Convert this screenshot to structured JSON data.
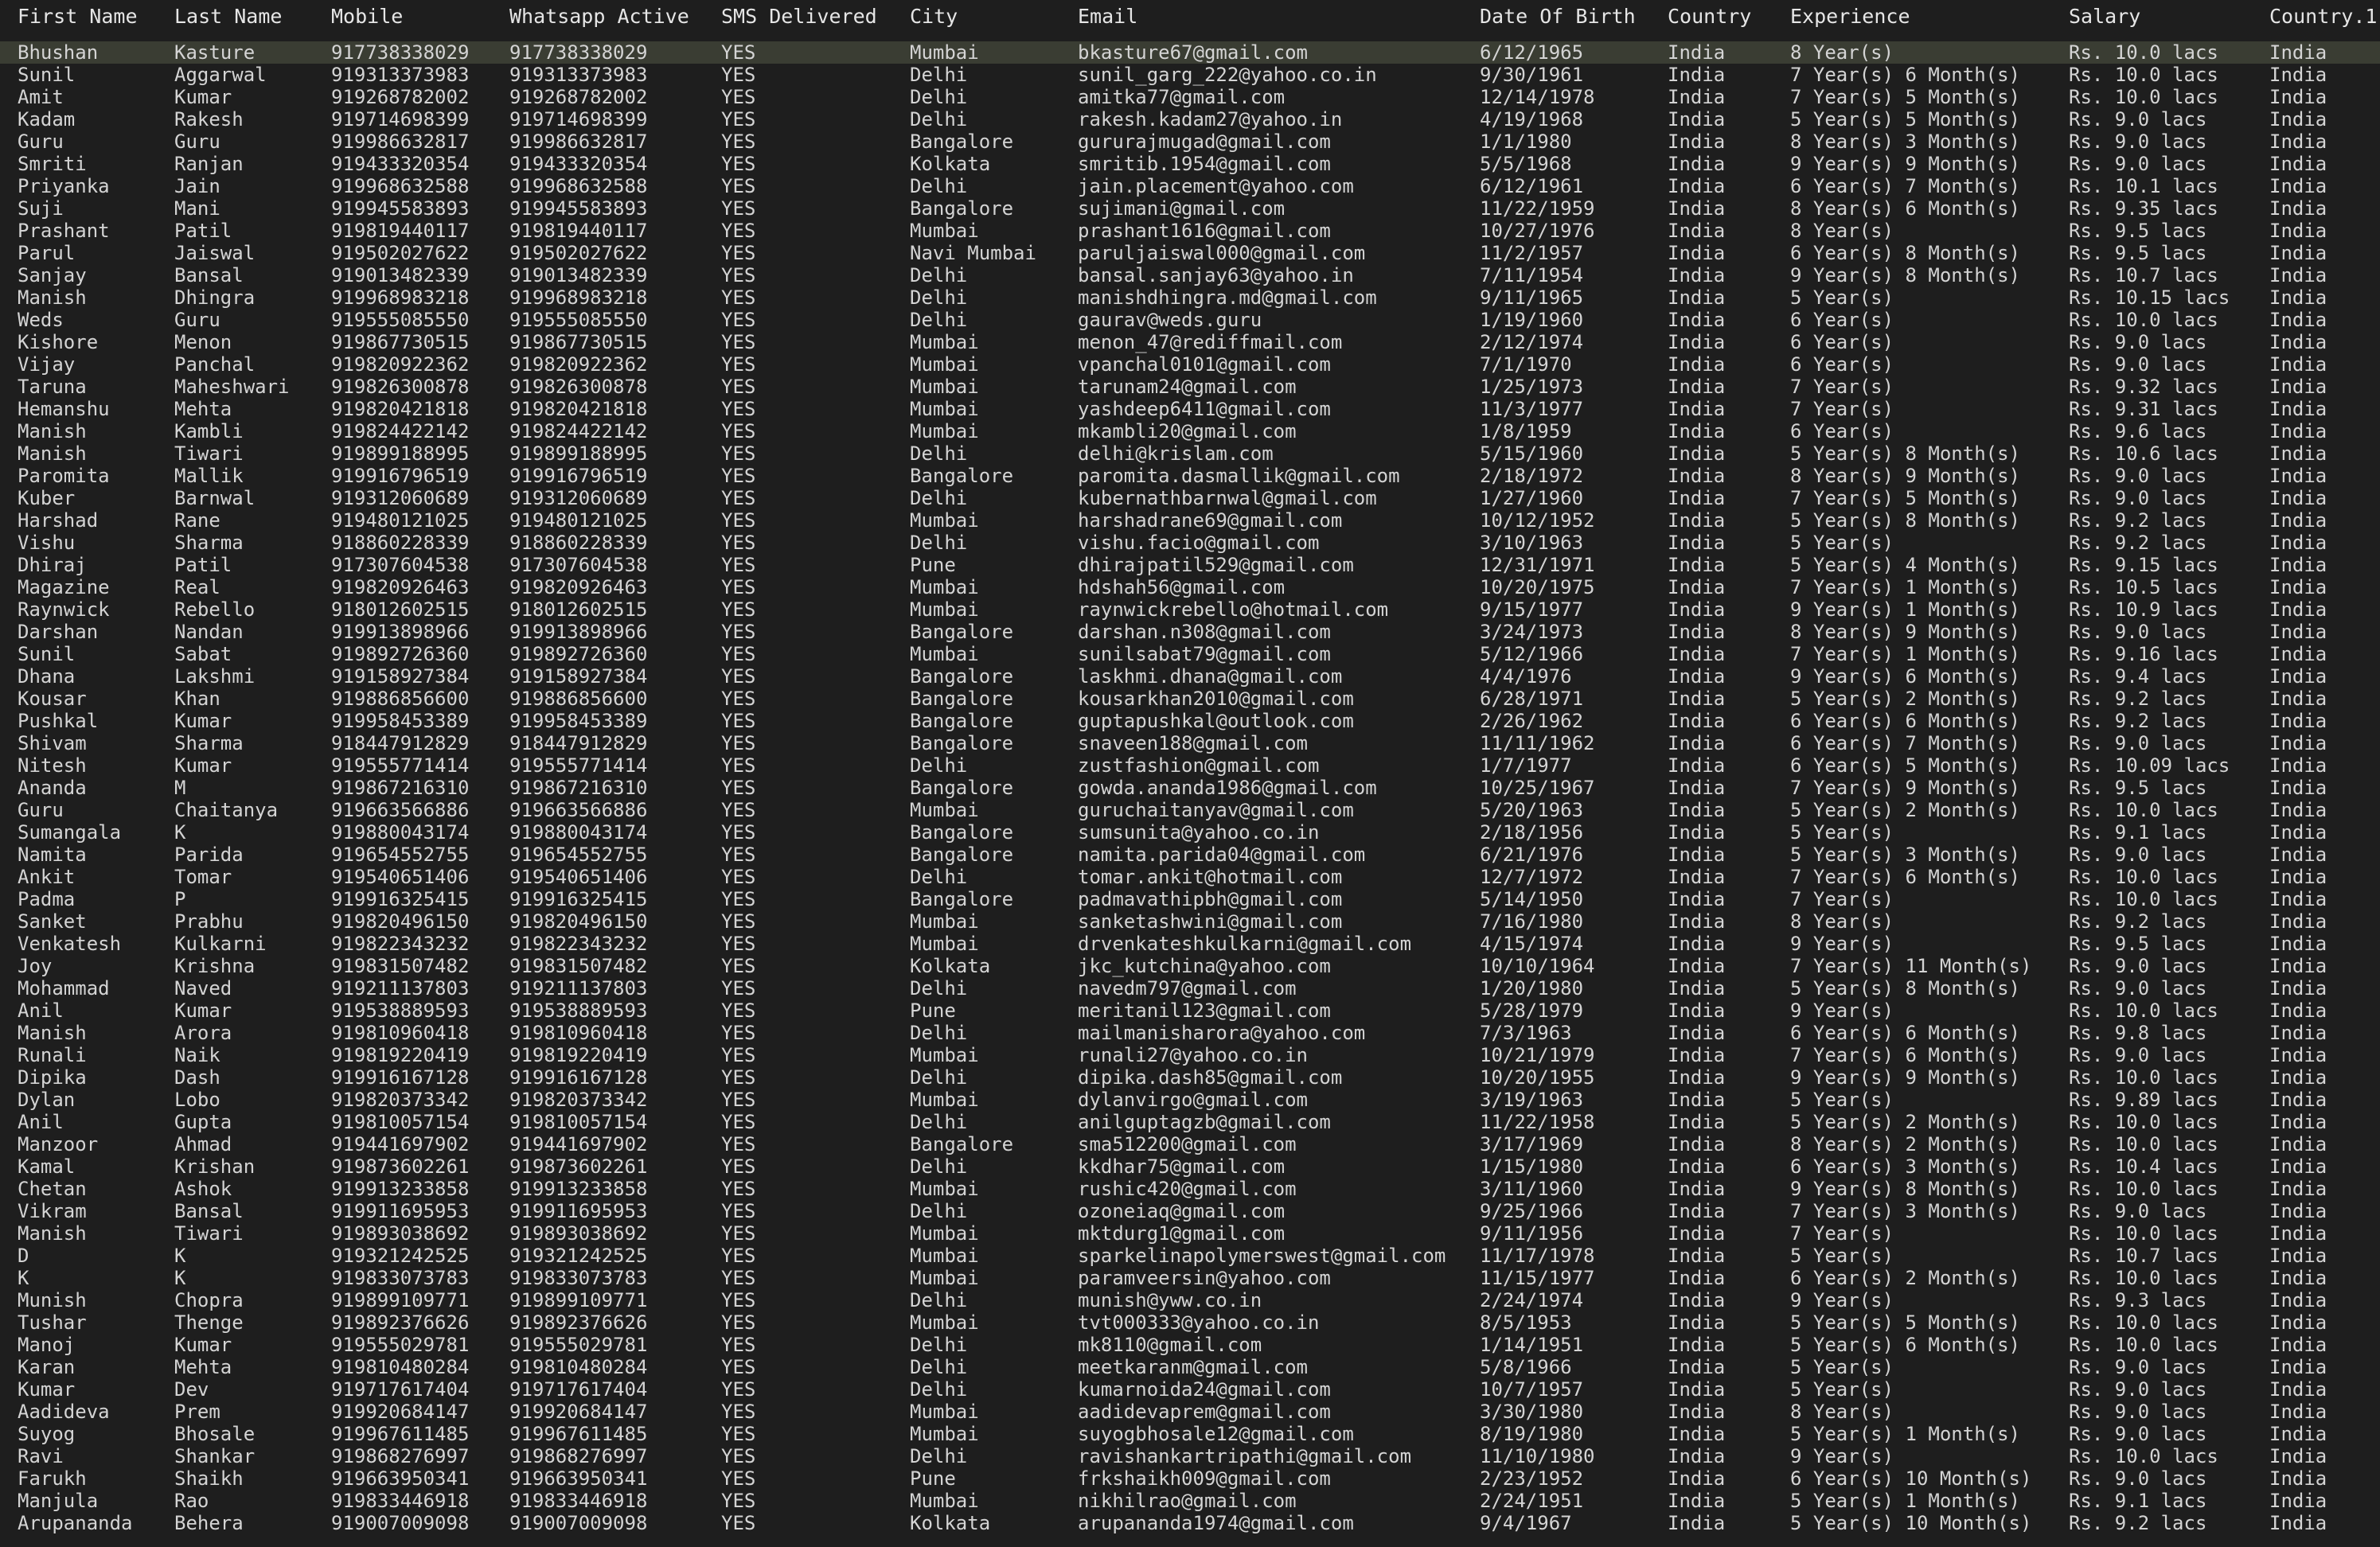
{
  "columns": [
    "First Name",
    "Last Name",
    "Mobile",
    "Whatsapp Active",
    "SMS Delivered",
    "City",
    "Email",
    "Date Of Birth",
    "Country",
    "Experience",
    "Salary",
    "Country.1"
  ],
  "rows": [
    [
      "Bhushan",
      "Kasture",
      "917738338029",
      "917738338029",
      "YES",
      "Mumbai",
      "bkasture67@gmail.com",
      "6/12/1965",
      "India",
      "8 Year(s)",
      "Rs. 10.0 lacs",
      "India"
    ],
    [
      "Sunil",
      "Aggarwal",
      "919313373983",
      "919313373983",
      "YES",
      "Delhi",
      "sunil_garg_222@yahoo.co.in",
      "9/30/1961",
      "India",
      "7 Year(s) 6 Month(s)",
      "Rs. 10.0 lacs",
      "India"
    ],
    [
      "Amit",
      "Kumar",
      "919268782002",
      "919268782002",
      "YES",
      "Delhi",
      "amitka77@gmail.com",
      "12/14/1978",
      "India",
      "7 Year(s) 5 Month(s)",
      "Rs. 10.0 lacs",
      "India"
    ],
    [
      "Kadam",
      "Rakesh",
      "919714698399",
      "919714698399",
      "YES",
      "Delhi",
      "rakesh.kadam27@yahoo.in",
      "4/19/1968",
      "India",
      "5 Year(s) 5 Month(s)",
      "Rs. 9.0 lacs",
      "India"
    ],
    [
      "Guru",
      "Guru",
      "919986632817",
      "919986632817",
      "YES",
      "Bangalore",
      "gururajmugad@gmail.com",
      "1/1/1980",
      "India",
      "8 Year(s) 3 Month(s)",
      "Rs. 9.0 lacs",
      "India"
    ],
    [
      "Smriti",
      "Ranjan",
      "919433320354",
      "919433320354",
      "YES",
      "Kolkata",
      "smritib.1954@gmail.com",
      "5/5/1968",
      "India",
      "9 Year(s) 9 Month(s)",
      "Rs. 9.0 lacs",
      "India"
    ],
    [
      "Priyanka",
      "Jain",
      "919968632588",
      "919968632588",
      "YES",
      "Delhi",
      "jain.placement@yahoo.com",
      "6/12/1961",
      "India",
      "6 Year(s) 7 Month(s)",
      "Rs. 10.1 lacs",
      "India"
    ],
    [
      "Suji",
      "Mani",
      "919945583893",
      "919945583893",
      "YES",
      "Bangalore",
      "sujimani@gmail.com",
      "11/22/1959",
      "India",
      "8 Year(s) 6 Month(s)",
      "Rs. 9.35 lacs",
      "India"
    ],
    [
      "Prashant",
      "Patil",
      "919819440117",
      "919819440117",
      "YES",
      "Mumbai",
      "prashant1616@gmail.com",
      "10/27/1976",
      "India",
      "8 Year(s)",
      "Rs. 9.5 lacs",
      "India"
    ],
    [
      "Parul",
      "Jaiswal",
      "919502027622",
      "919502027622",
      "YES",
      "Navi Mumbai",
      "paruljaiswal000@gmail.com",
      "11/2/1957",
      "India",
      "6 Year(s) 8 Month(s)",
      "Rs. 9.5 lacs",
      "India"
    ],
    [
      "Sanjay",
      "Bansal",
      "919013482339",
      "919013482339",
      "YES",
      "Delhi",
      "bansal.sanjay63@yahoo.in",
      "7/11/1954",
      "India",
      "9 Year(s) 8 Month(s)",
      "Rs. 10.7 lacs",
      "India"
    ],
    [
      "Manish",
      "Dhingra",
      "919968983218",
      "919968983218",
      "YES",
      "Delhi",
      "manishdhingra.md@gmail.com",
      "9/11/1965",
      "India",
      "5 Year(s)",
      "Rs. 10.15 lacs",
      "India"
    ],
    [
      "Weds",
      "Guru",
      "919555085550",
      "919555085550",
      "YES",
      "Delhi",
      "gaurav@weds.guru",
      "1/19/1960",
      "India",
      "6 Year(s)",
      "Rs. 10.0 lacs",
      "India"
    ],
    [
      "Kishore",
      "Menon",
      "919867730515",
      "919867730515",
      "YES",
      "Mumbai",
      "menon_47@rediffmail.com",
      "2/12/1974",
      "India",
      "6 Year(s)",
      "Rs. 9.0 lacs",
      "India"
    ],
    [
      "Vijay",
      "Panchal",
      "919820922362",
      "919820922362",
      "YES",
      "Mumbai",
      "vpanchal0101@gmail.com",
      "7/1/1970",
      "India",
      "6 Year(s)",
      "Rs. 9.0 lacs",
      "India"
    ],
    [
      "Taruna",
      "Maheshwari",
      "919826300878",
      "919826300878",
      "YES",
      "Mumbai",
      "tarunam24@gmail.com",
      "1/25/1973",
      "India",
      "7 Year(s)",
      "Rs. 9.32 lacs",
      "India"
    ],
    [
      "Hemanshu",
      "Mehta",
      "919820421818",
      "919820421818",
      "YES",
      "Mumbai",
      "yashdeep6411@gmail.com",
      "11/3/1977",
      "India",
      "7 Year(s)",
      "Rs. 9.31 lacs",
      "India"
    ],
    [
      "Manish",
      "Kambli",
      "919824422142",
      "919824422142",
      "YES",
      "Mumbai",
      "mkambli20@gmail.com",
      "1/8/1959",
      "India",
      "6 Year(s)",
      "Rs. 9.6 lacs",
      "India"
    ],
    [
      "Manish",
      "Tiwari",
      "919899188995",
      "919899188995",
      "YES",
      "Delhi",
      "delhi@krislam.com",
      "5/15/1960",
      "India",
      "5 Year(s) 8 Month(s)",
      "Rs. 10.6 lacs",
      "India"
    ],
    [
      "Paromita",
      "Mallik",
      "919916796519",
      "919916796519",
      "YES",
      "Bangalore",
      "paromita.dasmallik@gmail.com",
      "2/18/1972",
      "India",
      "8 Year(s) 9 Month(s)",
      "Rs. 9.0 lacs",
      "India"
    ],
    [
      "Kuber",
      "Barnwal",
      "919312060689",
      "919312060689",
      "YES",
      "Delhi",
      "kubernathbarnwal@gmail.com",
      "1/27/1960",
      "India",
      "7 Year(s) 5 Month(s)",
      "Rs. 9.0 lacs",
      "India"
    ],
    [
      "Harshad",
      "Rane",
      "919480121025",
      "919480121025",
      "YES",
      "Mumbai",
      "harshadrane69@gmail.com",
      "10/12/1952",
      "India",
      "5 Year(s) 8 Month(s)",
      "Rs. 9.2 lacs",
      "India"
    ],
    [
      "Vishu",
      "Sharma",
      "918860228339",
      "918860228339",
      "YES",
      "Delhi",
      "vishu.facio@gmail.com",
      "3/10/1963",
      "India",
      "5 Year(s)",
      "Rs. 9.2 lacs",
      "India"
    ],
    [
      "Dhiraj",
      "Patil",
      "917307604538",
      "917307604538",
      "YES",
      "Pune",
      "dhirajpatil529@gmail.com",
      "12/31/1971",
      "India",
      "5 Year(s) 4 Month(s)",
      "Rs. 9.15 lacs",
      "India"
    ],
    [
      "Magazine",
      "Real",
      "919820926463",
      "919820926463",
      "YES",
      "Mumbai",
      "hdshah56@gmail.com",
      "10/20/1975",
      "India",
      "7 Year(s) 1 Month(s)",
      "Rs. 10.5 lacs",
      "India"
    ],
    [
      "Raynwick",
      "Rebello",
      "918012602515",
      "918012602515",
      "YES",
      "Mumbai",
      "raynwickrebello@hotmail.com",
      "9/15/1977",
      "India",
      "9 Year(s) 1 Month(s)",
      "Rs. 10.9 lacs",
      "India"
    ],
    [
      "Darshan",
      "Nandan",
      "919913898966",
      "919913898966",
      "YES",
      "Bangalore",
      "darshan.n308@gmail.com",
      "3/24/1973",
      "India",
      "8 Year(s) 9 Month(s)",
      "Rs. 9.0 lacs",
      "India"
    ],
    [
      "Sunil",
      "Sabat",
      "919892726360",
      "919892726360",
      "YES",
      "Mumbai",
      "sunilsabat79@gmail.com",
      "5/12/1966",
      "India",
      "7 Year(s) 1 Month(s)",
      "Rs. 9.16 lacs",
      "India"
    ],
    [
      "Dhana",
      "Lakshmi",
      "919158927384",
      "919158927384",
      "YES",
      "Bangalore",
      "laskhmi.dhana@gmail.com",
      "4/4/1976",
      "India",
      "9 Year(s) 6 Month(s)",
      "Rs. 9.4 lacs",
      "India"
    ],
    [
      "Kousar",
      "Khan",
      "919886856600",
      "919886856600",
      "YES",
      "Bangalore",
      "kousarkhan2010@gmail.com",
      "6/28/1971",
      "India",
      "5 Year(s) 2 Month(s)",
      "Rs. 9.2 lacs",
      "India"
    ],
    [
      "Pushkal",
      "Kumar",
      "919958453389",
      "919958453389",
      "YES",
      "Bangalore",
      "guptapushkal@outlook.com",
      "2/26/1962",
      "India",
      "6 Year(s) 6 Month(s)",
      "Rs. 9.2 lacs",
      "India"
    ],
    [
      "Shivam",
      "Sharma",
      "918447912829",
      "918447912829",
      "YES",
      "Bangalore",
      "snaveen188@gmail.com",
      "11/11/1962",
      "India",
      "6 Year(s) 7 Month(s)",
      "Rs. 9.0 lacs",
      "India"
    ],
    [
      "Nitesh",
      "Kumar",
      "919555771414",
      "919555771414",
      "YES",
      "Delhi",
      "zustfashion@gmail.com",
      "1/7/1977",
      "India",
      "6 Year(s) 5 Month(s)",
      "Rs. 10.09 lacs",
      "India"
    ],
    [
      "Ananda",
      "M",
      "919867216310",
      "919867216310",
      "YES",
      "Bangalore",
      "gowda.ananda1986@gmail.com",
      "10/25/1967",
      "India",
      "7 Year(s) 9 Month(s)",
      "Rs. 9.5 lacs",
      "India"
    ],
    [
      "Guru",
      "Chaitanya",
      "919663566886",
      "919663566886",
      "YES",
      "Mumbai",
      "guruchaitanyav@gmail.com",
      "5/20/1963",
      "India",
      "5 Year(s) 2 Month(s)",
      "Rs. 10.0 lacs",
      "India"
    ],
    [
      "Sumangala",
      "K",
      "919880043174",
      "919880043174",
      "YES",
      "Bangalore",
      "sumsunita@yahoo.co.in",
      "2/18/1956",
      "India",
      "5 Year(s)",
      "Rs. 9.1 lacs",
      "India"
    ],
    [
      "Namita",
      "Parida",
      "919654552755",
      "919654552755",
      "YES",
      "Bangalore",
      "namita.parida04@gmail.com",
      "6/21/1976",
      "India",
      "5 Year(s) 3 Month(s)",
      "Rs. 9.0 lacs",
      "India"
    ],
    [
      "Ankit",
      "Tomar",
      "919540651406",
      "919540651406",
      "YES",
      "Delhi",
      "tomar.ankit@hotmail.com",
      "12/7/1972",
      "India",
      "7 Year(s) 6 Month(s)",
      "Rs. 10.0 lacs",
      "India"
    ],
    [
      "Padma",
      "P",
      "919916325415",
      "919916325415",
      "YES",
      "Bangalore",
      "padmavathipbh@gmail.com",
      "5/14/1950",
      "India",
      "7 Year(s)",
      "Rs. 10.0 lacs",
      "India"
    ],
    [
      "Sanket",
      "Prabhu",
      "919820496150",
      "919820496150",
      "YES",
      "Mumbai",
      "sanketashwini@gmail.com",
      "7/16/1980",
      "India",
      "8 Year(s)",
      "Rs. 9.2 lacs",
      "India"
    ],
    [
      "Venkatesh",
      "Kulkarni",
      "919822343232",
      "919822343232",
      "YES",
      "Mumbai",
      "drvenkateshkulkarni@gmail.com",
      "4/15/1974",
      "India",
      "9 Year(s)",
      "Rs. 9.5 lacs",
      "India"
    ],
    [
      "Joy",
      "Krishna",
      "919831507482",
      "919831507482",
      "YES",
      "Kolkata",
      "jkc_kutchina@yahoo.com",
      "10/10/1964",
      "India",
      "7 Year(s) 11 Month(s)",
      "Rs. 9.0 lacs",
      "India"
    ],
    [
      "Mohammad",
      "Naved",
      "919211137803",
      "919211137803",
      "YES",
      "Delhi",
      "navedm797@gmail.com",
      "1/20/1980",
      "India",
      "5 Year(s) 8 Month(s)",
      "Rs. 9.0 lacs",
      "India"
    ],
    [
      "Anil",
      "Kumar",
      "919538889593",
      "919538889593",
      "YES",
      "Pune",
      "meritanil123@gmail.com",
      "5/28/1979",
      "India",
      "9 Year(s)",
      "Rs. 10.0 lacs",
      "India"
    ],
    [
      "Manish",
      "Arora",
      "919810960418",
      "919810960418",
      "YES",
      "Delhi",
      "mailmanisharora@yahoo.com",
      "7/3/1963",
      "India",
      "6 Year(s) 6 Month(s)",
      "Rs. 9.8 lacs",
      "India"
    ],
    [
      "Runali",
      "Naik",
      "919819220419",
      "919819220419",
      "YES",
      "Mumbai",
      "runali27@yahoo.co.in",
      "10/21/1979",
      "India",
      "7 Year(s) 6 Month(s)",
      "Rs. 9.0 lacs",
      "India"
    ],
    [
      "Dipika",
      "Dash",
      "919916167128",
      "919916167128",
      "YES",
      "Delhi",
      "dipika.dash85@gmail.com",
      "10/20/1955",
      "India",
      "9 Year(s) 9 Month(s)",
      "Rs. 10.0 lacs",
      "India"
    ],
    [
      "Dylan",
      "Lobo",
      "919820373342",
      "919820373342",
      "YES",
      "Mumbai",
      "dylanvirgo@gmail.com",
      "3/19/1963",
      "India",
      "5 Year(s)",
      "Rs. 9.89 lacs",
      "India"
    ],
    [
      "Anil",
      "Gupta",
      "919810057154",
      "919810057154",
      "YES",
      "Delhi",
      "anilguptagzb@gmail.com",
      "11/22/1958",
      "India",
      "5 Year(s) 2 Month(s)",
      "Rs. 10.0 lacs",
      "India"
    ],
    [
      "Manzoor",
      "Ahmad",
      "919441697902",
      "919441697902",
      "YES",
      "Bangalore",
      "sma512200@gmail.com",
      "3/17/1969",
      "India",
      "8 Year(s) 2 Month(s)",
      "Rs. 10.0 lacs",
      "India"
    ],
    [
      "Kamal",
      "Krishan",
      "919873602261",
      "919873602261",
      "YES",
      "Delhi",
      "kkdhar75@gmail.com",
      "1/15/1980",
      "India",
      "6 Year(s) 3 Month(s)",
      "Rs. 10.4 lacs",
      "India"
    ],
    [
      "Chetan",
      "Ashok",
      "919913233858",
      "919913233858",
      "YES",
      "Mumbai",
      "rushic420@gmail.com",
      "3/11/1960",
      "India",
      "9 Year(s) 8 Month(s)",
      "Rs. 10.0 lacs",
      "India"
    ],
    [
      "Vikram",
      "Bansal",
      "919911695953",
      "919911695953",
      "YES",
      "Delhi",
      "ozoneiaq@gmail.com",
      "9/25/1966",
      "India",
      "7 Year(s) 3 Month(s)",
      "Rs. 9.0 lacs",
      "India"
    ],
    [
      "Manish",
      "Tiwari",
      "919893038692",
      "919893038692",
      "YES",
      "Mumbai",
      "mktdurg1@gmail.com",
      "9/11/1956",
      "India",
      "7 Year(s)",
      "Rs. 10.0 lacs",
      "India"
    ],
    [
      "D",
      "K",
      "919321242525",
      "919321242525",
      "YES",
      "Mumbai",
      "sparkelinapolymerswest@gmail.com",
      "11/17/1978",
      "India",
      "5 Year(s)",
      "Rs. 10.7 lacs",
      "India"
    ],
    [
      "K",
      "K",
      "919833073783",
      "919833073783",
      "YES",
      "Mumbai",
      "paramveersin@yahoo.com",
      "11/15/1977",
      "India",
      "6 Year(s) 2 Month(s)",
      "Rs. 10.0 lacs",
      "India"
    ],
    [
      "Munish",
      "Chopra",
      "919899109771",
      "919899109771",
      "YES",
      "Delhi",
      "munish@yww.co.in",
      "2/24/1974",
      "India",
      "9 Year(s)",
      "Rs. 9.3 lacs",
      "India"
    ],
    [
      "Tushar",
      "Thenge",
      "919892376626",
      "919892376626",
      "YES",
      "Mumbai",
      "tvt000333@yahoo.co.in",
      "8/5/1953",
      "India",
      "5 Year(s) 5 Month(s)",
      "Rs. 10.0 lacs",
      "India"
    ],
    [
      "Manoj",
      "Kumar",
      "919555029781",
      "919555029781",
      "YES",
      "Delhi",
      "mk8110@gmail.com",
      "1/14/1951",
      "India",
      "5 Year(s) 6 Month(s)",
      "Rs. 10.0 lacs",
      "India"
    ],
    [
      "Karan",
      "Mehta",
      "919810480284",
      "919810480284",
      "YES",
      "Delhi",
      "meetkaranm@gmail.com",
      "5/8/1966",
      "India",
      "5 Year(s)",
      "Rs. 9.0 lacs",
      "India"
    ],
    [
      "Kumar",
      "Dev",
      "919717617404",
      "919717617404",
      "YES",
      "Delhi",
      "kumarnoida24@gmail.com",
      "10/7/1957",
      "India",
      "5 Year(s)",
      "Rs. 9.0 lacs",
      "India"
    ],
    [
      "Aadideva",
      "Prem",
      "919920684147",
      "919920684147",
      "YES",
      "Mumbai",
      "aadidevaprem@gmail.com",
      "3/30/1980",
      "India",
      "8 Year(s)",
      "Rs. 9.0 lacs",
      "India"
    ],
    [
      "Suyog",
      "Bhosale",
      "919967611485",
      "919967611485",
      "YES",
      "Mumbai",
      "suyogbhosale12@gmail.com",
      "8/19/1980",
      "India",
      "5 Year(s) 1 Month(s)",
      "Rs. 9.0 lacs",
      "India"
    ],
    [
      "Ravi",
      "Shankar",
      "919868276997",
      "919868276997",
      "YES",
      "Delhi",
      "ravishankartripathi@gmail.com",
      "11/10/1980",
      "India",
      "9 Year(s)",
      "Rs. 10.0 lacs",
      "India"
    ],
    [
      "Farukh",
      "Shaikh",
      "919663950341",
      "919663950341",
      "YES",
      "Pune",
      "frkshaikh009@gmail.com",
      "2/23/1952",
      "India",
      "6 Year(s) 10 Month(s)",
      "Rs. 9.0 lacs",
      "India"
    ],
    [
      "Manjula",
      "Rao",
      "919833446918",
      "919833446918",
      "YES",
      "Mumbai",
      "nikhilrao@gmail.com",
      "2/24/1951",
      "India",
      "5 Year(s) 1 Month(s)",
      "Rs. 9.1 lacs",
      "India"
    ],
    [
      "Arupananda",
      "Behera",
      "919007009098",
      "919007009098",
      "YES",
      "Kolkata",
      "arupananda1974@gmail.com",
      "9/4/1967",
      "India",
      "5 Year(s) 10 Month(s)",
      "Rs. 9.2 lacs",
      "India"
    ]
  ]
}
